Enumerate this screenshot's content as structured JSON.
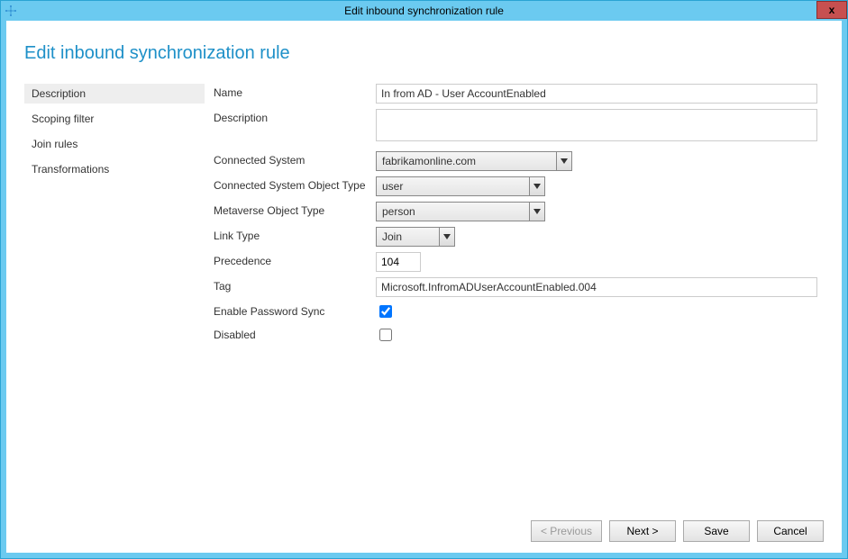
{
  "window": {
    "title": "Edit inbound synchronization rule",
    "close_text": "x"
  },
  "page": {
    "heading": "Edit inbound synchronization rule"
  },
  "sidebar": {
    "items": [
      {
        "label": "Description",
        "selected": true
      },
      {
        "label": "Scoping filter",
        "selected": false
      },
      {
        "label": "Join rules",
        "selected": false
      },
      {
        "label": "Transformations",
        "selected": false
      }
    ]
  },
  "form": {
    "name_label": "Name",
    "name_value": "In from AD - User AccountEnabled",
    "description_label": "Description",
    "description_value": "",
    "connected_system_label": "Connected System",
    "connected_system_value": "fabrikamonline.com",
    "cs_object_type_label": "Connected System Object Type",
    "cs_object_type_value": "user",
    "mv_object_type_label": "Metaverse Object Type",
    "mv_object_type_value": "person",
    "link_type_label": "Link Type",
    "link_type_value": "Join",
    "precedence_label": "Precedence",
    "precedence_value": "104",
    "tag_label": "Tag",
    "tag_value": "Microsoft.InfromADUserAccountEnabled.004",
    "enable_pwd_sync_label": "Enable Password Sync",
    "enable_pwd_sync_checked": true,
    "disabled_label": "Disabled",
    "disabled_checked": false
  },
  "buttons": {
    "previous": "< Previous",
    "next": "Next >",
    "save": "Save",
    "cancel": "Cancel"
  }
}
